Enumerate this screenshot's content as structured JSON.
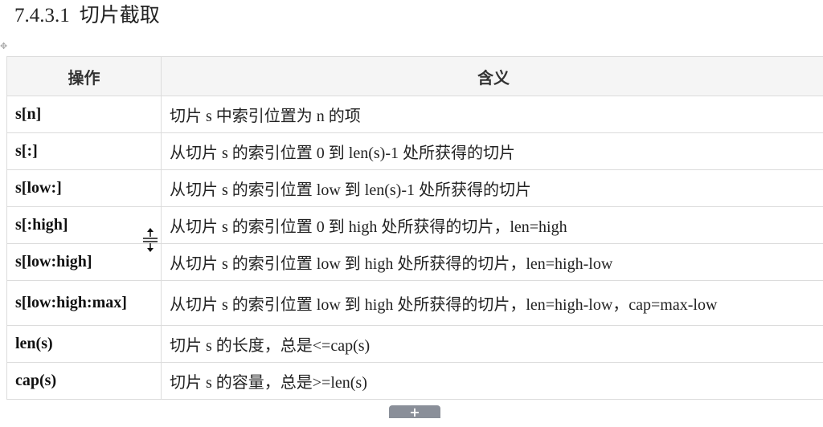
{
  "heading": {
    "number": "7.4.3.1",
    "title": "切片截取"
  },
  "table": {
    "headers": {
      "op": "操作",
      "desc": "含义"
    },
    "rows": [
      {
        "op": "s[n]",
        "desc": "切片 s 中索引位置为 n 的项"
      },
      {
        "op": "s[:]",
        "desc": "从切片 s 的索引位置 0 到 len(s)-1 处所获得的切片"
      },
      {
        "op": "s[low:]",
        "desc": "从切片 s 的索引位置 low 到 len(s)-1 处所获得的切片"
      },
      {
        "op": "s[:high]",
        "desc": "从切片 s 的索引位置 0 到 high 处所获得的切片，len=high"
      },
      {
        "op": "s[low:high]",
        "desc": "从切片 s 的索引位置 low 到 high 处所获得的切片，len=high-low"
      },
      {
        "op": "s[low:high:max]",
        "desc": "从切片 s 的索引位置 low 到 high 处所获得的切片，len=high-low，cap=max-low"
      },
      {
        "op": "len(s)",
        "desc": "切片 s 的长度，总是<=cap(s)"
      },
      {
        "op": "cap(s)",
        "desc": "切片 s 的容量，总是>=len(s)"
      }
    ]
  },
  "controls": {
    "add_row_symbol": "+",
    "move_handle_symbol": "✥"
  }
}
